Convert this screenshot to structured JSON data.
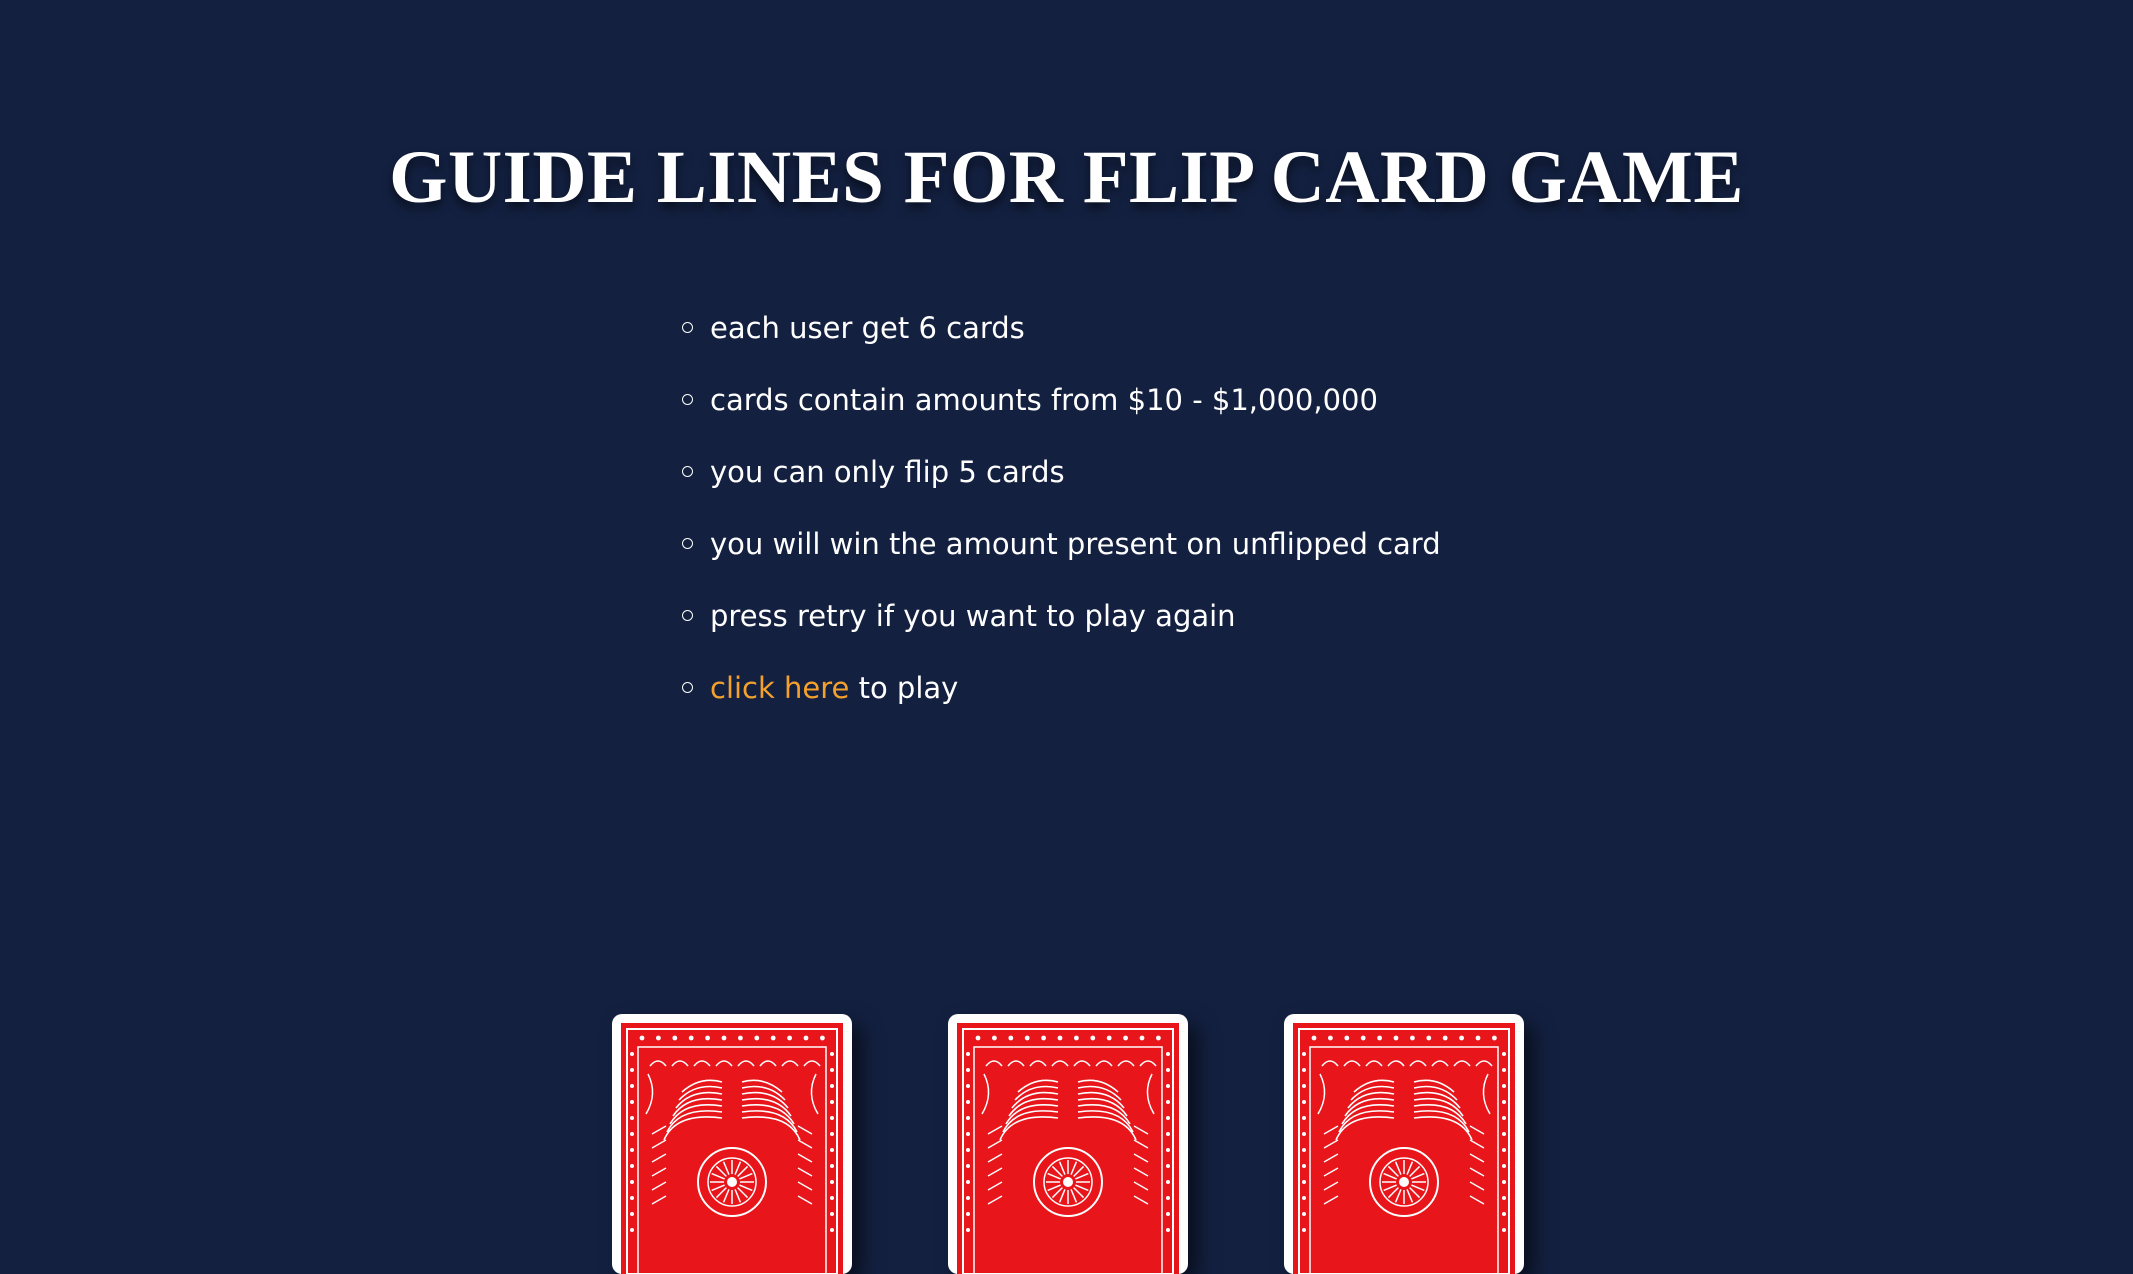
{
  "page": {
    "title": "GUIDE LINES FOR FLIP CARD GAME"
  },
  "rules": [
    "each user get 6 cards",
    "cards contain amounts from $10 - $1,000,000",
    "you can only flip 5 cards",
    "you will win the amount present on unflipped card",
    "press retry if you want to play again"
  ],
  "play": {
    "link_text": "click here",
    "suffix": " to play"
  },
  "colors": {
    "background": "#132040",
    "link": "#f4a02c",
    "card_back": "#e8151b"
  },
  "cards": [
    {
      "icon": "card-back-icon"
    },
    {
      "icon": "card-back-icon"
    },
    {
      "icon": "card-back-icon"
    }
  ]
}
